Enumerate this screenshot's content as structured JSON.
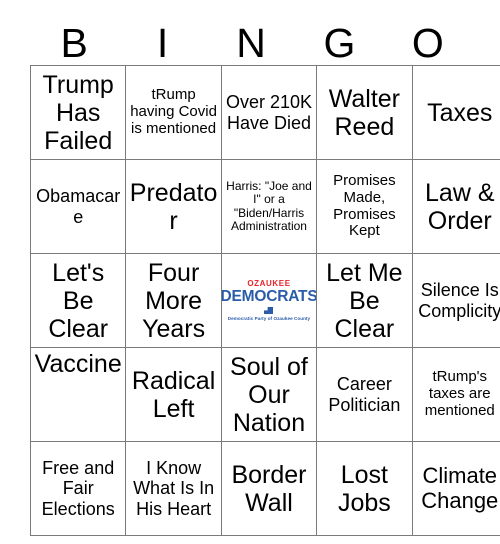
{
  "card": {
    "header_letters": [
      "B",
      "I",
      "N",
      "G",
      "O"
    ],
    "rows": [
      [
        {
          "text": "Trump Has Failed",
          "size": "xl"
        },
        {
          "text": "tRump having Covid is mentioned",
          "size": "sm"
        },
        {
          "text": "Over 210K Have Died",
          "size": "md"
        },
        {
          "text": "Walter Reed",
          "size": "xl"
        },
        {
          "text": "Taxes",
          "size": "xl"
        }
      ],
      [
        {
          "text": "Obamacare",
          "size": "md"
        },
        {
          "text": "Predator",
          "size": "xl"
        },
        {
          "text": "Harris: \"Joe and I\" or a \"Biden/Harris Administration",
          "size": "xs"
        },
        {
          "text": "Promises Made, Promises Kept",
          "size": "sm"
        },
        {
          "text": "Law & Order",
          "size": "xl"
        }
      ],
      [
        {
          "text": "Let's Be Clear",
          "size": "xl"
        },
        {
          "text": "Four More Years",
          "size": "xl"
        },
        {
          "type": "logo"
        },
        {
          "text": "Let Me Be Clear",
          "size": "xl"
        },
        {
          "text": "Silence Is Complicity",
          "size": "md"
        }
      ],
      [
        {
          "text": "Vaccine",
          "size": "xl",
          "align": "top"
        },
        {
          "text": "Radical Left",
          "size": "xl"
        },
        {
          "text": "Soul of Our Nation",
          "size": "xl"
        },
        {
          "text": "Career Politician",
          "size": "md"
        },
        {
          "text": "tRump's taxes are mentioned",
          "size": "sm"
        }
      ],
      [
        {
          "text": "Free and Fair Elections",
          "size": "md"
        },
        {
          "text": "I Know What Is In His Heart",
          "size": "md"
        },
        {
          "text": "Border Wall",
          "size": "xl"
        },
        {
          "text": "Lost Jobs",
          "size": "xl"
        },
        {
          "text": "Climate Change",
          "size": "lg"
        }
      ]
    ],
    "logo": {
      "top_line": "OZAUKEE",
      "main_line": "DEMOCRATS",
      "sub_line": "Democratic Party of Ozaukee County",
      "red": "#E8242A",
      "blue": "#2A5CAA"
    },
    "border_color": "#7a7a7a",
    "background": "#ffffff"
  }
}
